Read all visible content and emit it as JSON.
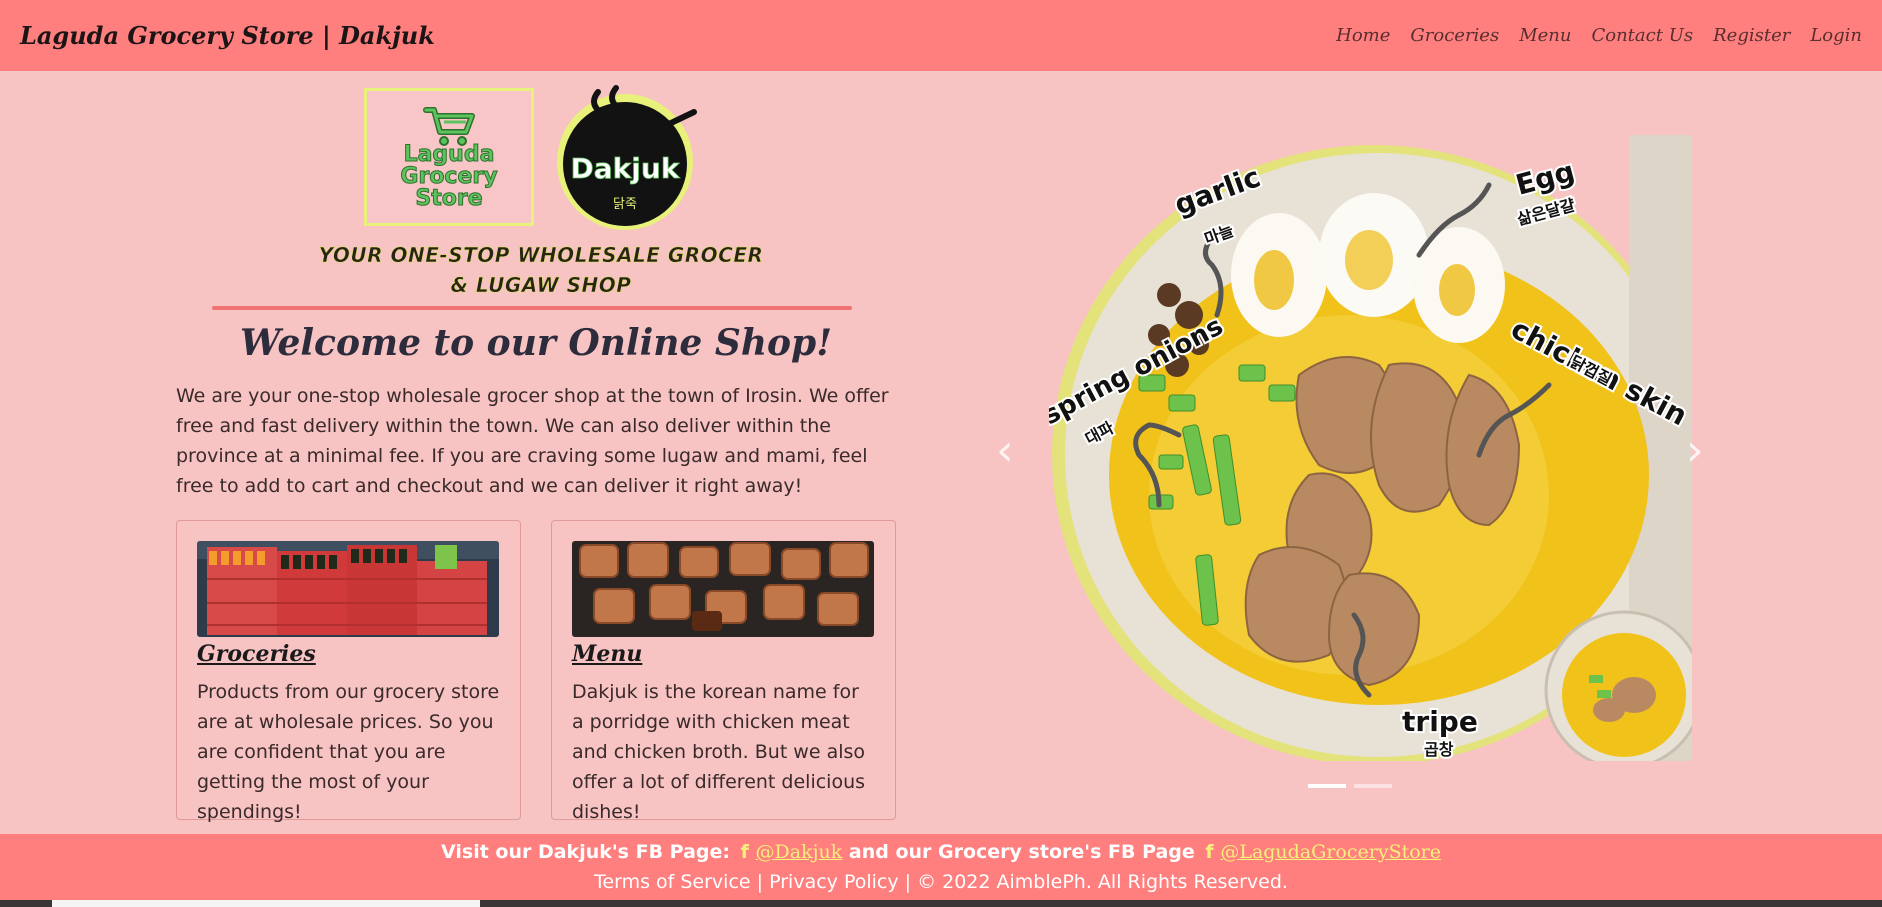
{
  "navbar": {
    "brand": "Laguda Grocery Store | Dakjuk",
    "links": [
      "Home",
      "Groceries",
      "Menu",
      "Contact Us",
      "Register",
      "Login"
    ]
  },
  "logos": {
    "grocery_lines": [
      "Laguda",
      "Grocery",
      "Store"
    ],
    "dakjuk_name": "Dakjuk",
    "dakjuk_korean": "닭죽",
    "slogan_line1": "YOUR ONE-STOP WHOLESALE GROCER",
    "slogan_line2": "& LUGAW SHOP"
  },
  "welcome": {
    "title": "Welcome to our Online Shop!",
    "text": "We are your one-stop wholesale grocer shop at the town of Irosin. We offer free and fast delivery within the town. We can also deliver within the province at a minimal fee. If you are craving some lugaw and mami, feel free to add to cart and checkout and we can deliver it right away!"
  },
  "cards": [
    {
      "title": "Groceries",
      "text": "Products from our grocery store are at wholesale prices. So you are confident that you are getting the most of your spendings!"
    },
    {
      "title": "Menu",
      "text": "Dakjuk is the korean name for a porridge with chicken meat and chicken broth. But we also offer a lot of different delicious dishes!"
    }
  ],
  "carousel": {
    "labels": {
      "garlic": "garlic",
      "garlic_ko": "마늘",
      "egg": "Egg",
      "egg_ko": "삶은달걀",
      "spring_onions": "spring onions",
      "spring_onions_ko": "대파",
      "chicken_skin": "chicken skin",
      "chicken_skin_ko": "닭껍질",
      "tripe": "tripe",
      "tripe_ko": "곱창"
    },
    "prev_symbol": "‹",
    "next_symbol": "›",
    "slide_count": 2,
    "active_index": 0
  },
  "footer": {
    "fb_prefix": "Visit our Dakjuk's FB Page:",
    "fb_dakjuk": "@Dakjuk",
    "fb_middle": "and our Grocery store's FB Page",
    "fb_grocery": "@LagudaGroceryStore",
    "fb_icon": "f",
    "terms": "Terms of Service",
    "privacy": "Privacy Policy",
    "copyright": "© 2022 AimblePh. All Rights Reserved."
  },
  "colors": {
    "navbar_bg": "#ff7f7f",
    "page_bg": "#f7c3c3",
    "accent_yellow": "#f5f07a",
    "logo_green": "#5cc45c"
  }
}
